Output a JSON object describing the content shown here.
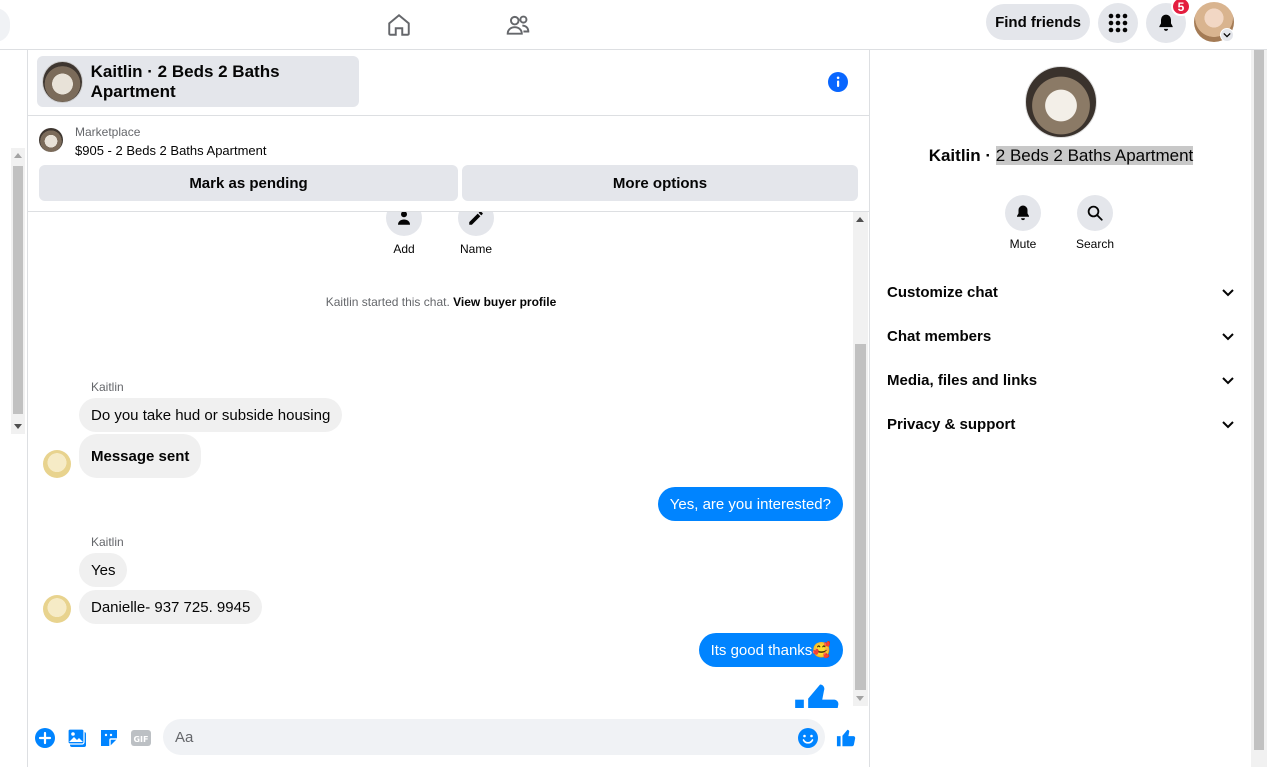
{
  "nav": {
    "find_friends": "Find friends",
    "notification_count": "5"
  },
  "chat": {
    "title": "Kaitlin · 2 Beds 2 Baths Apartment",
    "marketplace_label": "Marketplace",
    "listing": "$905 - 2 Beds 2 Baths Apartment",
    "mark_pending": "Mark as pending",
    "more_options": "More options",
    "top_actions": [
      "Add",
      "Name"
    ],
    "started_text": "Kaitlin started this chat.",
    "view_buyer_profile": "View buyer profile",
    "messages": [
      {
        "from": "Kaitlin",
        "sender_label": "Kaitlin",
        "text": "Do you take hud or subside housing"
      },
      {
        "from": "Kaitlin",
        "text": "Message sent"
      },
      {
        "from": "me",
        "text": "Yes, are you interested?"
      },
      {
        "from": "Kaitlin",
        "sender_label": "Kaitlin",
        "text": "Yes"
      },
      {
        "from": "Kaitlin",
        "text": "Danielle- 937 725. 9945"
      },
      {
        "from": "me",
        "text": "Its good thanks🥰"
      }
    ],
    "composer_placeholder": "Aa"
  },
  "details": {
    "name_prefix": "Kaitlin · ",
    "name_selected": "2 Beds 2 Baths Apartment",
    "actions": [
      "Mute",
      "Search"
    ],
    "sections": [
      "Customize chat",
      "Chat members",
      "Media, files and links",
      "Privacy & support"
    ]
  },
  "colors": {
    "accent": "#0084ff",
    "badge": "#e41e3f"
  }
}
